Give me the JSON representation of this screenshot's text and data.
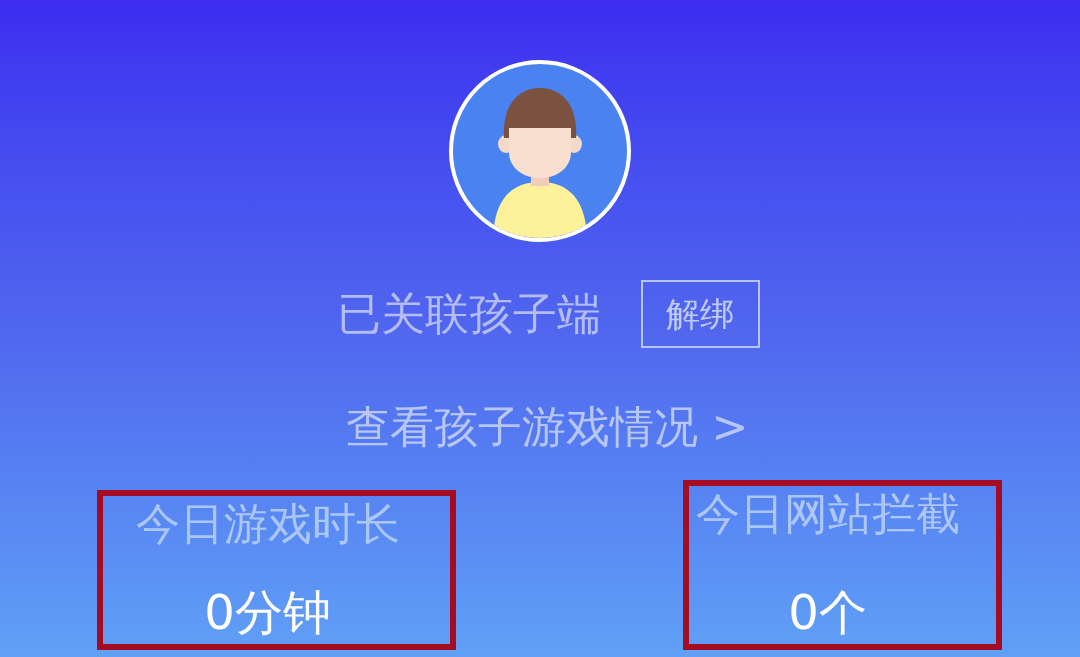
{
  "link_status": {
    "label": "已关联孩子端",
    "button": "解绑"
  },
  "view_link": {
    "label": "查看孩子游戏情况 >"
  },
  "stats": [
    {
      "label": "今日游戏时长",
      "value": "0分钟",
      "highlighted": true
    },
    {
      "label": "今日网站拦截",
      "value": "0个",
      "highlighted": true
    }
  ]
}
